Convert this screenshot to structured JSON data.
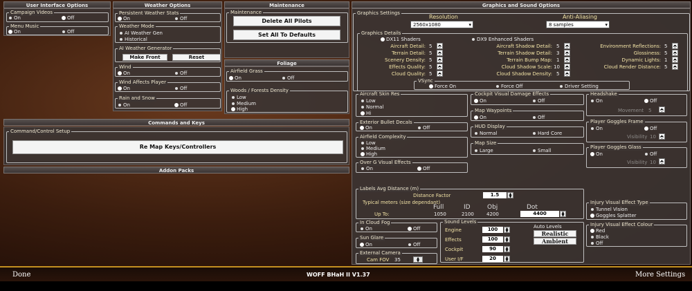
{
  "ui": {
    "header": "User Interface Options",
    "campaign_videos": "Campaign Videos",
    "on": "On",
    "off": "Off",
    "menu_music": "Menu Music"
  },
  "weather": {
    "header": "Weather Options",
    "persistent": "Persistent Weather Stats",
    "mode": "Weather Mode",
    "ai_gen": "AI Weather Gen",
    "historical": "Historical",
    "ai_gen_title": "AI Weather Generator",
    "make_front": "Make Front",
    "reset": "Reset",
    "wind": "Wind",
    "wind_affects": "Wind Affects Player",
    "rain": "Rain and Snow"
  },
  "maint": {
    "header": "Maintenance",
    "title": "Maintenance",
    "delete": "Delete All Pilots",
    "defaults": "Set All To Defaults"
  },
  "foliage": {
    "header": "Foliage",
    "airfield": "Airfield Grass",
    "woods": "Woods / Forests Density",
    "low": "Low",
    "medium": "Medium",
    "high": "High"
  },
  "commands": {
    "header": "Commands and Keys",
    "setup": "Command/Control Setup",
    "remap": "Re Map Keys/Controllers"
  },
  "addon": {
    "header": "Addon Packs"
  },
  "gfx": {
    "header": "Graphics and Sound Options",
    "settings": "Graphics Settings",
    "resolution": "Resolution",
    "res_val": "2560x1080",
    "aa": "Anti-Aliasing",
    "aa_val": "8 samples",
    "details": "Graphics Details",
    "dx11": "DX11 Shaders",
    "dx9": "DX9 Enhanced Shaders",
    "c1": [
      {
        "l": "Aircraft Detail:",
        "v": "5"
      },
      {
        "l": "Terrain Detail:",
        "v": "5"
      },
      {
        "l": "Scenery Density:",
        "v": "5"
      },
      {
        "l": "Effects Quality:",
        "v": "5"
      },
      {
        "l": "Cloud Quality:",
        "v": "5"
      }
    ],
    "c2": [
      {
        "l": "Aircraft Shadow Detail:",
        "v": "5"
      },
      {
        "l": "Terrain Shadow Detail:",
        "v": "3"
      },
      {
        "l": "Terrain Bump Map:",
        "v": "1"
      },
      {
        "l": "Cloud Shadow Scale:",
        "v": "10"
      },
      {
        "l": "Cloud Shadow Density:",
        "v": "5"
      }
    ],
    "c3": [
      {
        "l": "Environment Reflections:",
        "v": "5"
      },
      {
        "l": "Glossiness:",
        "v": "5"
      },
      {
        "l": "Dynamic Lights:",
        "v": "1"
      },
      {
        "l": "Cloud Render Distance:",
        "v": "5"
      }
    ],
    "vsync": "VSync",
    "force_on": "Force On",
    "force_off": "Force Off",
    "driver": "Driver Setting",
    "skin": "Aircraft Skin Res",
    "low": "Low",
    "normal": "Normal",
    "hi": "Hi",
    "cockpit_dmg": "Cockpit Visual Damage Effects",
    "waypoints": "Map Waypoints",
    "hud": "HUD Display",
    "hud_normal": "Normal",
    "hard_core": "Hard Core",
    "map_size": "Map Size",
    "large": "Large",
    "small": "Small",
    "exterior_decals": "Exterior Bullet Decals",
    "complexity": "Airfield Complexity",
    "medium": "Medium",
    "high": "High",
    "overg": "Over G  Visual Effects",
    "headshake": "Headshake",
    "movement": "Movement",
    "movement_val": "5",
    "goggles_frame": "Player Goggles Frame",
    "visibility": "Visibility",
    "vis1": "10",
    "goggles_glass": "Player Goggles Glass",
    "vis2": "10",
    "labels": "Labels Avg Distance (m)",
    "distance": "Distance Factor",
    "dist_val": "1.5",
    "typical": "Typical meters (size dependant)",
    "full": "Full",
    "id": "ID",
    "obj": "Obj",
    "dot": "Dot",
    "upto": "Up To:",
    "full_v": "1050",
    "id_v": "2100",
    "obj_v": "4200",
    "dot_v": "4400",
    "injury_type": "Injury Visual Effect Type",
    "tunnel": "Tunnel Vision",
    "splatter": "Goggles Splatter",
    "injury_colour": "Injury Visual Effect Colour",
    "red": "Red",
    "black": "Black",
    "cloudfog": "In Cloud Fog",
    "sunglare": "Sun Glare",
    "extcam": "External Camera",
    "camfov": "Cam FOV",
    "camfov_v": "35",
    "sound": "Sound Levels",
    "engine": "Engine",
    "engine_v": "100",
    "effects": "Effects",
    "effects_v": "100",
    "cockpit": "Cockpit",
    "cockpit_v": "90",
    "useri": "User I/F",
    "useri_v": "20",
    "auto": "Auto Levels",
    "realistic": "Realistic",
    "ambient": "Ambient",
    "on": "On",
    "off": "Off"
  },
  "footer": {
    "done": "Done",
    "version": "WOFF BHaH II V1.37",
    "more": "More Settings"
  }
}
